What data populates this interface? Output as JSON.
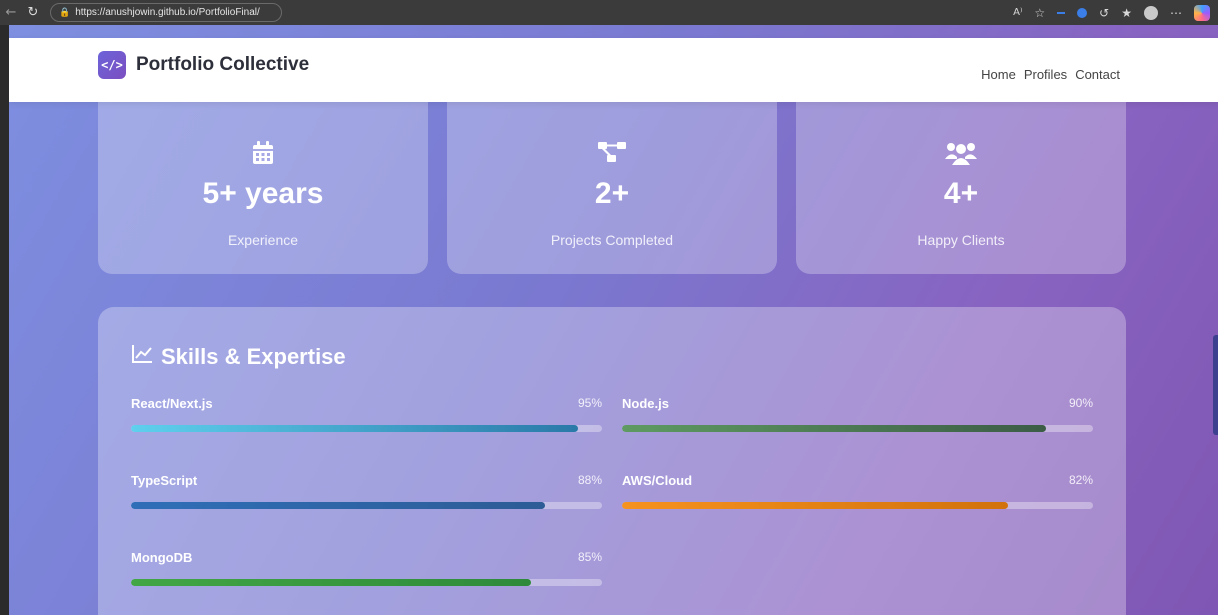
{
  "browser": {
    "url": "https://anushjowin.github.io/PortfolioFinal/"
  },
  "header": {
    "logo_text": "</>",
    "brand": "Portfolio Collective",
    "nav": [
      "Home",
      "Profiles",
      "Contact"
    ]
  },
  "stats": [
    {
      "icon": "calendar-icon",
      "value": "5+ years",
      "label": "Experience"
    },
    {
      "icon": "project-diagram-icon",
      "value": "2+",
      "label": "Projects Completed"
    },
    {
      "icon": "users-icon",
      "value": "4+",
      "label": "Happy Clients"
    }
  ],
  "skills": {
    "title": "Skills & Expertise",
    "icon": "chart-line-icon",
    "items": [
      {
        "name": "React/Next.js",
        "percent_label": "95%",
        "level": 95,
        "color_start": "#5fd0ee",
        "color_end": "#2a79a8"
      },
      {
        "name": "Node.js",
        "percent_label": "90%",
        "level": 90,
        "color_start": "#5e9a62",
        "color_end": "#3c5c46"
      },
      {
        "name": "TypeScript",
        "percent_label": "88%",
        "level": 88,
        "color_start": "#2f6fb8",
        "color_end": "#2d5c96"
      },
      {
        "name": "AWS/Cloud",
        "percent_label": "82%",
        "level": 82,
        "color_start": "#f6921e",
        "color_end": "#d1720c"
      },
      {
        "name": "MongoDB",
        "percent_label": "85%",
        "level": 85,
        "color_start": "#42a645",
        "color_end": "#2e8a3a"
      }
    ]
  }
}
